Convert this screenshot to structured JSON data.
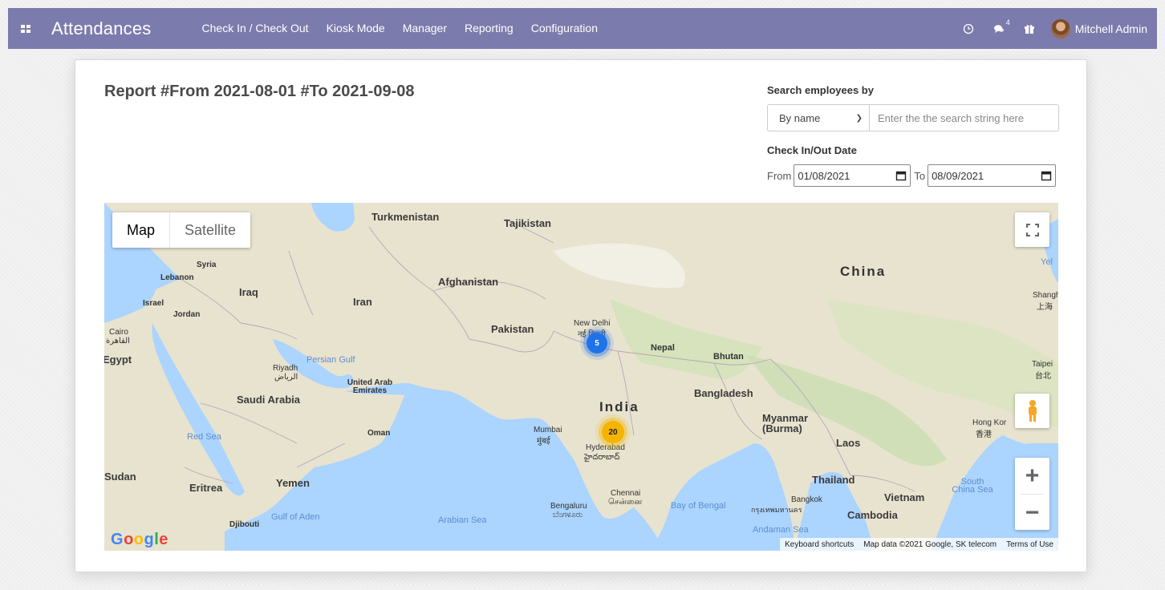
{
  "navbar": {
    "app_title": "Attendances",
    "menu": [
      {
        "label": "Check In / Check Out"
      },
      {
        "label": "Kiosk Mode"
      },
      {
        "label": "Manager"
      },
      {
        "label": "Reporting"
      },
      {
        "label": "Configuration"
      }
    ],
    "messages_badge": "4",
    "user_name": "Mitchell Admin",
    "icons": [
      "apps-icon",
      "clock-icon",
      "chat-icon",
      "gift-icon"
    ],
    "color": "#7c7bad"
  },
  "report": {
    "title": "Report #From 2021-08-01 #To 2021-09-08"
  },
  "filters": {
    "search_label": "Search employees by",
    "search_by_selected": "By name",
    "search_placeholder": "Enter the the search string here",
    "date_label": "Check In/Out Date",
    "from_label": "From",
    "from_value": "01/08/2021",
    "to_label": "To",
    "to_value": "08/09/2021"
  },
  "map": {
    "map_type": {
      "map": "Map",
      "satellite": "Satellite",
      "selected": "Map"
    },
    "clusters": [
      {
        "label": "5",
        "near": "New Delhi",
        "color": "#1f73e8"
      },
      {
        "label": "20",
        "near": "Hyderabad",
        "color": "#f4b400"
      }
    ],
    "labels": {
      "turkmenistan": "Turkmenistan",
      "tajikistan": "Tajikistan",
      "syria": "Syria",
      "lebanon": "Lebanon",
      "iraq": "Iraq",
      "afghanistan": "Afghanistan",
      "china": "China",
      "yel": "Yel",
      "israel": "Israel",
      "jordan": "Jordan",
      "iran": "Iran",
      "shanghai": "Shangha",
      "shanghai_native": "上海",
      "cairo": "Cairo",
      "cairo_native": "القاهرة",
      "pakistan": "Pakistan",
      "new_delhi": "New Delhi",
      "new_delhi_native": "नई दिल्ली",
      "egypt": "Egypt",
      "persian_gulf": "Persian Gulf",
      "nepal": "Nepal",
      "bhutan": "Bhutan",
      "taipei": "Taipei",
      "taipei_native": "台北",
      "riyadh": "Riyadh",
      "riyadh_native": "الرياض",
      "uae": "United Arab Emirates",
      "saudi": "Saudi Arabia",
      "bangladesh": "Bangladesh",
      "india": "India",
      "myanmar": "Myanmar (Burma)",
      "hong_kong": "Hong Kor",
      "hong_kong_native": "香港",
      "red_sea": "Red Sea",
      "oman": "Oman",
      "mumbai": "Mumbai",
      "mumbai_native": "मुंबई",
      "hyderabad": "Hyderabad",
      "hyderabad_native": "హైదరాబాద్",
      "laos": "Laos",
      "sudan": "Sudan",
      "eritrea": "Eritrea",
      "yemen": "Yemen",
      "thailand": "Thailand",
      "south_china_sea": "South China Sea",
      "chennai": "Chennai",
      "chennai_native": "சென்னை",
      "vietnam": "Vietnam",
      "bangkok": "Bangkok",
      "bangkok_native": "กรุงเทพมหานคร",
      "gulf_aden": "Gulf of Aden",
      "bengaluru": "Bengaluru",
      "bengaluru_native": "ಬೆಂಗಳೂರು",
      "bay_bengal": "Bay of Bengal",
      "arabian_sea": "Arabian Sea",
      "cambodia": "Cambodia",
      "djibouti": "Djibouti",
      "andaman_sea": "Andaman Sea"
    },
    "footer": {
      "shortcuts": "Keyboard shortcuts",
      "data": "Map data ©2021 Google, SK telecom",
      "terms": "Terms of Use"
    },
    "logo": "Google"
  }
}
